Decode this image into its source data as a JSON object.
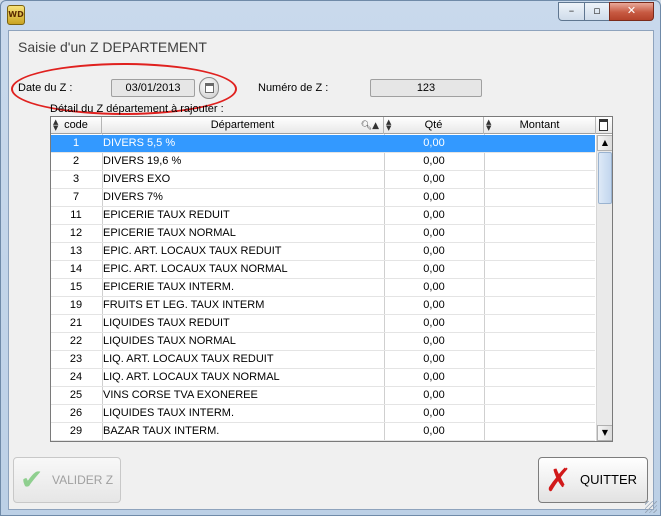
{
  "window": {
    "app_icon": "WD"
  },
  "window_controls": {
    "minimize": "–",
    "maximize": "▫",
    "close": "✕"
  },
  "form": {
    "title": "Saisie d'un Z DEPARTEMENT"
  },
  "date": {
    "label": "Date du Z :",
    "value": "03/01/2013"
  },
  "numero": {
    "label": "Numéro de Z :",
    "value": "123"
  },
  "grid": {
    "caption": "Détail du Z département à rajouter :",
    "columns": [
      "code",
      "Département",
      "Qté",
      "Montant"
    ],
    "rows": [
      {
        "code": "1",
        "dep": "DIVERS 5,5 %",
        "qte": "0,00",
        "montant": ""
      },
      {
        "code": "2",
        "dep": "DIVERS 19,6 %",
        "qte": "0,00",
        "montant": ""
      },
      {
        "code": "3",
        "dep": "DIVERS EXO",
        "qte": "0,00",
        "montant": ""
      },
      {
        "code": "7",
        "dep": "DIVERS 7%",
        "qte": "0,00",
        "montant": ""
      },
      {
        "code": "11",
        "dep": "EPICERIE TAUX REDUIT",
        "qte": "0,00",
        "montant": ""
      },
      {
        "code": "12",
        "dep": "EPICERIE TAUX NORMAL",
        "qte": "0,00",
        "montant": ""
      },
      {
        "code": "13",
        "dep": "EPIC. ART. LOCAUX TAUX REDUIT",
        "qte": "0,00",
        "montant": ""
      },
      {
        "code": "14",
        "dep": "EPIC. ART. LOCAUX TAUX NORMAL",
        "qte": "0,00",
        "montant": ""
      },
      {
        "code": "15",
        "dep": "EPICERIE TAUX INTERM.",
        "qte": "0,00",
        "montant": ""
      },
      {
        "code": "19",
        "dep": "FRUITS ET LEG. TAUX INTERM",
        "qte": "0,00",
        "montant": ""
      },
      {
        "code": "21",
        "dep": "LIQUIDES TAUX REDUIT",
        "qte": "0,00",
        "montant": ""
      },
      {
        "code": "22",
        "dep": "LIQUIDES TAUX NORMAL",
        "qte": "0,00",
        "montant": ""
      },
      {
        "code": "23",
        "dep": "LIQ. ART. LOCAUX TAUX REDUIT",
        "qte": "0,00",
        "montant": ""
      },
      {
        "code": "24",
        "dep": "LIQ. ART. LOCAUX TAUX NORMAL",
        "qte": "0,00",
        "montant": ""
      },
      {
        "code": "25",
        "dep": "VINS CORSE TVA EXONEREE",
        "qte": "0,00",
        "montant": ""
      },
      {
        "code": "26",
        "dep": "LIQUIDES TAUX INTERM.",
        "qte": "0,00",
        "montant": ""
      },
      {
        "code": "29",
        "dep": "BAZAR TAUX INTERM.",
        "qte": "0,00",
        "montant": ""
      }
    ],
    "selected_index": 0
  },
  "buttons": {
    "valider": "VALIDER Z",
    "quitter": "QUITTER"
  },
  "colors": {
    "selection": "#3399ff",
    "highlight_oval": "#e0211f",
    "quit_icon": "#d1191a"
  }
}
